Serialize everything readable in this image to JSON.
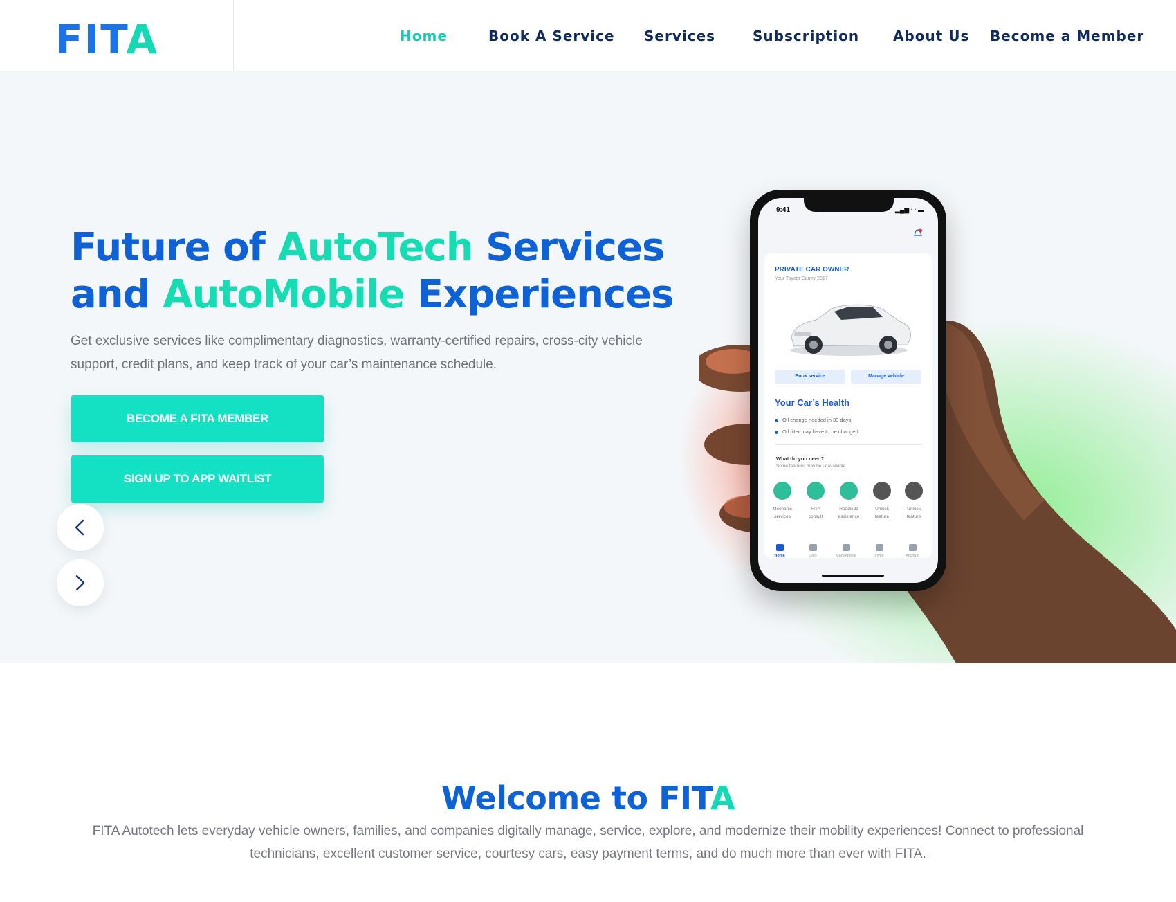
{
  "brand": {
    "logo_main": "FIT",
    "logo_accent": "A",
    "colors": {
      "primary": "#0e62d6",
      "accent": "#14e0c4",
      "nav_text": "#0f2a5c"
    }
  },
  "nav": {
    "items": [
      {
        "label": "Home",
        "active": true
      },
      {
        "label": "Book A Service",
        "active": false
      },
      {
        "label": "Services",
        "active": false
      },
      {
        "label": "Subscription",
        "active": false
      },
      {
        "label": "About Us",
        "active": false
      },
      {
        "label": "Become a Member",
        "active": false
      }
    ]
  },
  "hero": {
    "title_line1_a": "Future of ",
    "title_line1_accent": "AutoTech",
    "title_line1_b": " Services",
    "title_line2_a": "and ",
    "title_line2_accent": "AutoMobile",
    "title_line2_b": " Experiences",
    "description": "Get exclusive services like complimentary diagnostics, warranty-certified repairs, cross-city vehicle support, credit plans, and keep track of your car’s maintenance schedule.",
    "btn_member": "BECOME A FITA MEMBER",
    "btn_waitlist": "SIGN UP TO APP WAITLIST",
    "prev_icon": "chevron-left-icon",
    "next_icon": "chevron-right-icon"
  },
  "phone": {
    "time": "9:41",
    "owner_label": "PRIVATE CAR OWNER",
    "car_name": "Your Toyota Camry 2017",
    "book_service": "Book service",
    "manage_vehicle": "Manage vehicle",
    "health_title": "Your Car’s Health",
    "health_items": [
      "Oil change needed in 30 days.",
      "Oil filter may have to be changed"
    ],
    "need_title": "What do you need?",
    "need_sub": "Some features may be unavailable",
    "features": [
      {
        "line1": "Mechanic",
        "line2": "services"
      },
      {
        "line1": "FITA",
        "line2": "consult"
      },
      {
        "line1": "Roadside",
        "line2": "assistance"
      },
      {
        "line1": "Unlock",
        "line2": "feature"
      },
      {
        "line1": "Unlock",
        "line2": "feature"
      }
    ],
    "tabs": [
      "Home",
      "Cars",
      "Marketplace",
      "Invite",
      "Account"
    ]
  },
  "welcome": {
    "title_a": "Welcome to ",
    "title_fit": "FIT",
    "title_accent": "A",
    "description": "FITA Autotech lets everyday vehicle owners, families, and companies digitally manage, service, explore, and modernize their mobility experiences! Connect to professional technicians, excellent customer service, courtesy cars, easy payment terms, and do much more than ever with FITA."
  }
}
